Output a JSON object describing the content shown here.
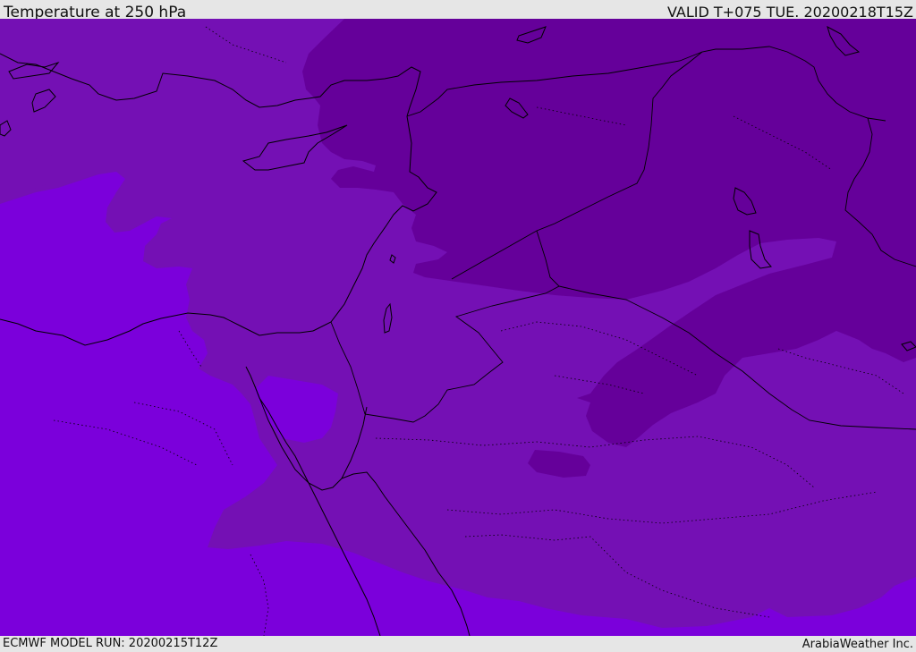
{
  "header": {
    "title": "Temperature at 250 hPa",
    "valid": "VALID T+075 TUE. 20200218T15Z"
  },
  "footer": {
    "model_run": "ECMWF MODEL RUN: 20200215T12Z",
    "credit": "ArabiaWeather Inc."
  },
  "colors": {
    "band_coldest": "#65009a",
    "band_mid": "#7410b4",
    "band_warm": "#7b00db",
    "coastline": "#000000",
    "border": "#000000",
    "bar_background": "#e6e6e6"
  }
}
